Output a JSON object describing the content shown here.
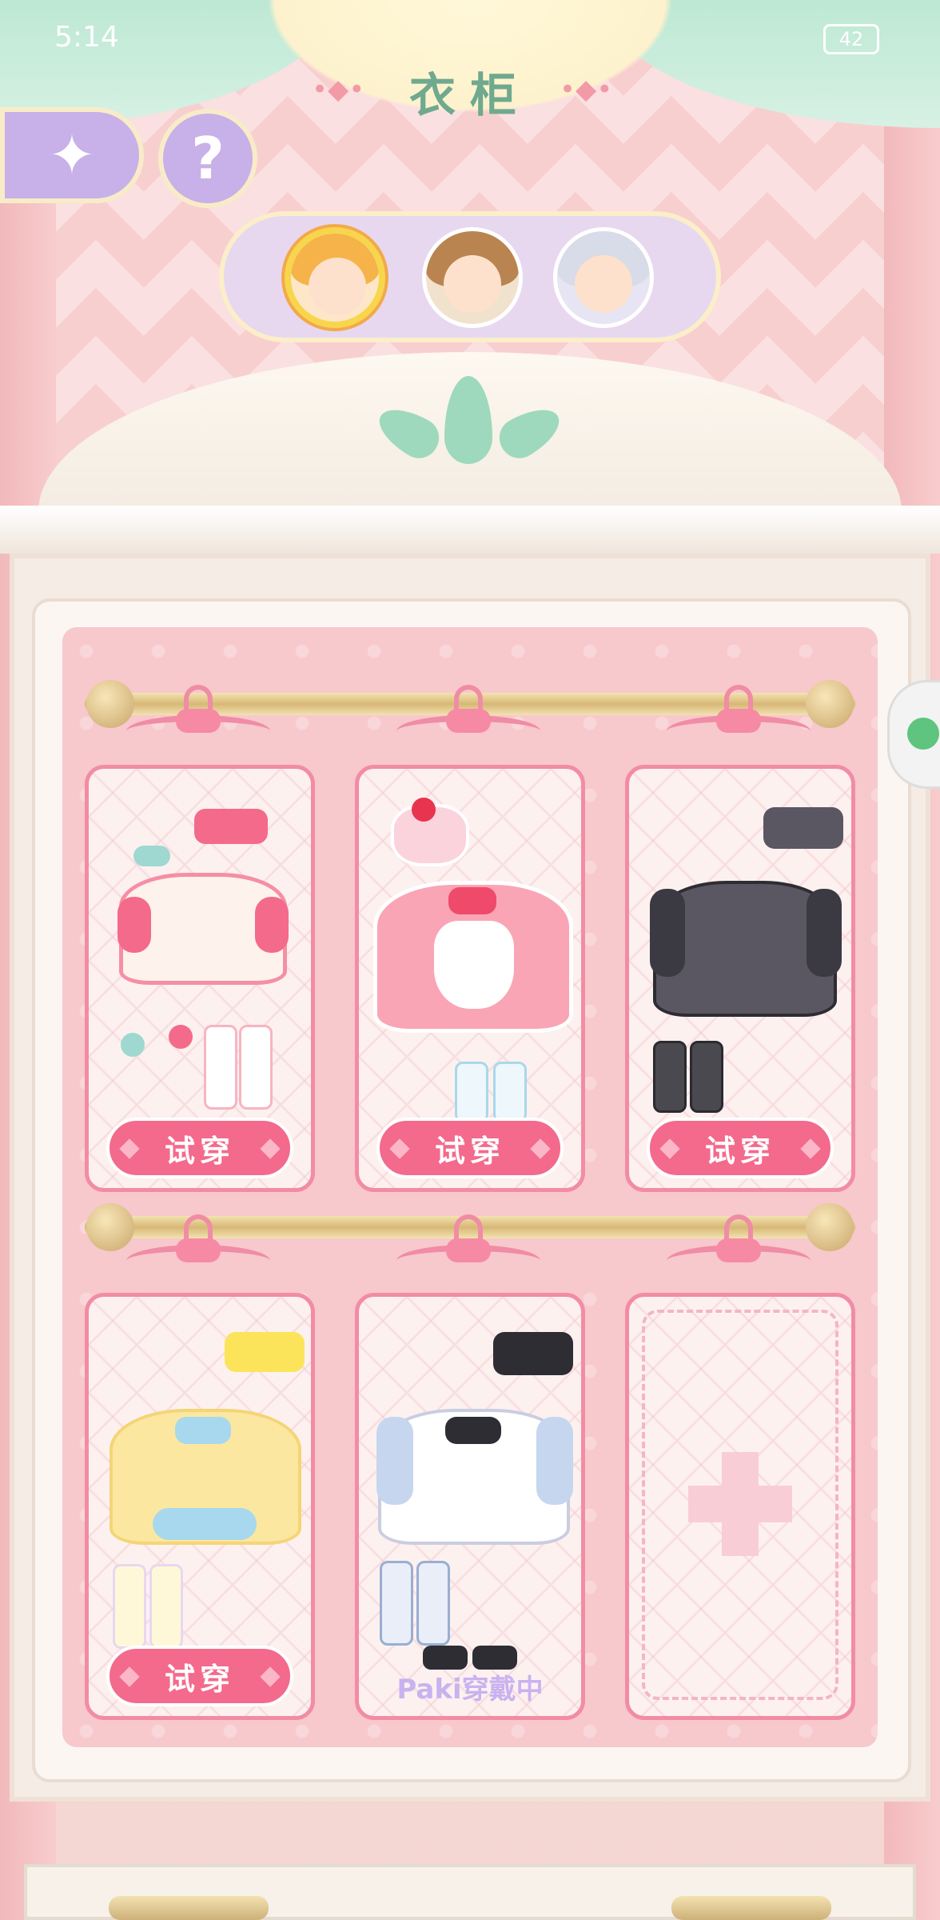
{
  "status_bar": {
    "time": "5:14",
    "battery": "42"
  },
  "header": {
    "title": "衣柜",
    "deco_left": "•◆•",
    "deco_right": "•◆•"
  },
  "controls": {
    "back_icon": "✦",
    "help_label": "?"
  },
  "characters": [
    {
      "name": "blonde-girl",
      "selected": true,
      "hair_color": "#f5b34a"
    },
    {
      "name": "brown-hair-boy",
      "selected": false,
      "hair_color": "#b98450"
    },
    {
      "name": "silver-hair-girl",
      "selected": false,
      "hair_color": "#d8dbe8"
    }
  ],
  "wardrobe": {
    "outfits": [
      {
        "name": "pink-lolita-outfit",
        "action": "试穿",
        "dress_color": "#fdeff0",
        "accent": "#f46a8a"
      },
      {
        "name": "strawberry-maid-outfit",
        "action": "试穿",
        "dress_color": "#f9a5b5",
        "accent": "#f04a6a"
      },
      {
        "name": "gothic-black-outfit",
        "action": "试穿",
        "dress_color": "#5a5762",
        "accent": "#2e2c33"
      },
      {
        "name": "yellow-sweet-outfit",
        "action": "试穿",
        "dress_color": "#fce7a0",
        "accent": "#a8d8ee"
      },
      {
        "name": "white-plaid-outfit",
        "status": "Paki穿戴中",
        "dress_color": "#ffffff",
        "accent": "#2d2d33"
      },
      {
        "name": "empty-slot",
        "empty": true
      }
    ]
  },
  "colors": {
    "accent_pink": "#f36a8c",
    "frame_pink": "#f28ca5",
    "lavender": "#c8b0e8",
    "mint": "#9ed9bd"
  }
}
